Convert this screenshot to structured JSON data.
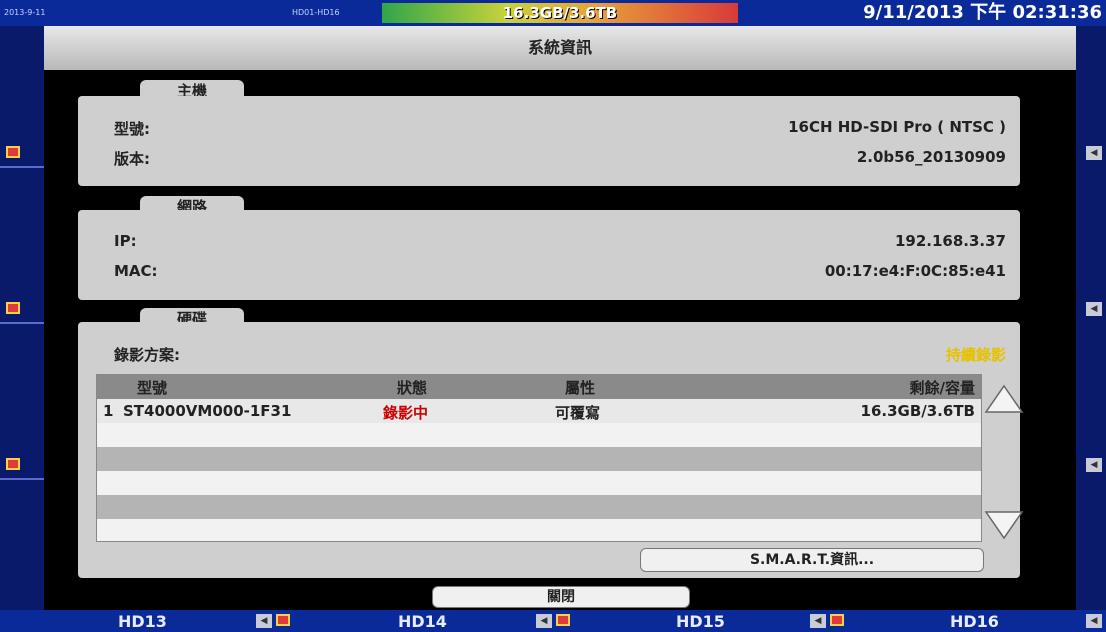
{
  "topbar": {
    "left_text_1": "2013-9-11",
    "left_text_2": "HD01-HD16",
    "disk_usage": "16.3GB/3.6TB",
    "clock": "9/11/2013 下午 02:31:36"
  },
  "dialog": {
    "title": "系統資訊",
    "host_section": {
      "tab": "主機",
      "model_label": "型號:",
      "model_value": "16CH HD-SDI Pro ( NTSC )",
      "version_label": "版本:",
      "version_value": "2.0b56_20130909"
    },
    "network_section": {
      "tab": "網路",
      "ip_label": "IP:",
      "ip_value": "192.168.3.37",
      "mac_label": "MAC:",
      "mac_value": "00:17:e4:F:0C:85:e41"
    },
    "hdd_section": {
      "tab": "硬碟",
      "record_mode_label": "錄影方案:",
      "record_mode_value": "持續錄影",
      "record_mode_color": "#e6c200",
      "columns": [
        "型號",
        "狀態",
        "屬性",
        "剩餘/容量"
      ],
      "rows": [
        {
          "index": "1",
          "model": "ST4000VM000-1F31",
          "status": "錄影中",
          "attribute": "可覆寫",
          "capacity": "16.3GB/3.6TB"
        }
      ],
      "status_color": "#cc0000",
      "smart_button": "S.M.A.R.T.資訊..."
    },
    "close_button": "關閉"
  },
  "channels": [
    "HD13",
    "HD14",
    "HD15",
    "HD16"
  ]
}
